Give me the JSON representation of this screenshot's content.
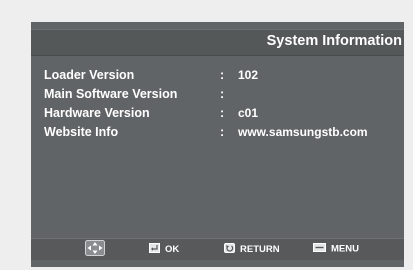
{
  "header": {
    "title": "System Information"
  },
  "info": [
    {
      "label": "Loader Version",
      "value": "102"
    },
    {
      "label": "Main Software Version",
      "value": ""
    },
    {
      "label": "Hardware Version",
      "value": "c01"
    },
    {
      "label": "Website Info",
      "value": "www.samsungstb.com"
    }
  ],
  "separator": ":",
  "footer": {
    "nav_icon": "navigation-arrows-icon",
    "ok_icon": "enter-key-icon",
    "ok_label": "OK",
    "return_icon": "return-arrow-icon",
    "return_label": "RETURN",
    "menu_icon": "menu-key-icon",
    "menu_label": "MENU"
  },
  "colors": {
    "screen_bg": "#616466",
    "title_bar": "#555859",
    "footer_bar": "#58595b",
    "text": "#ffffff"
  }
}
